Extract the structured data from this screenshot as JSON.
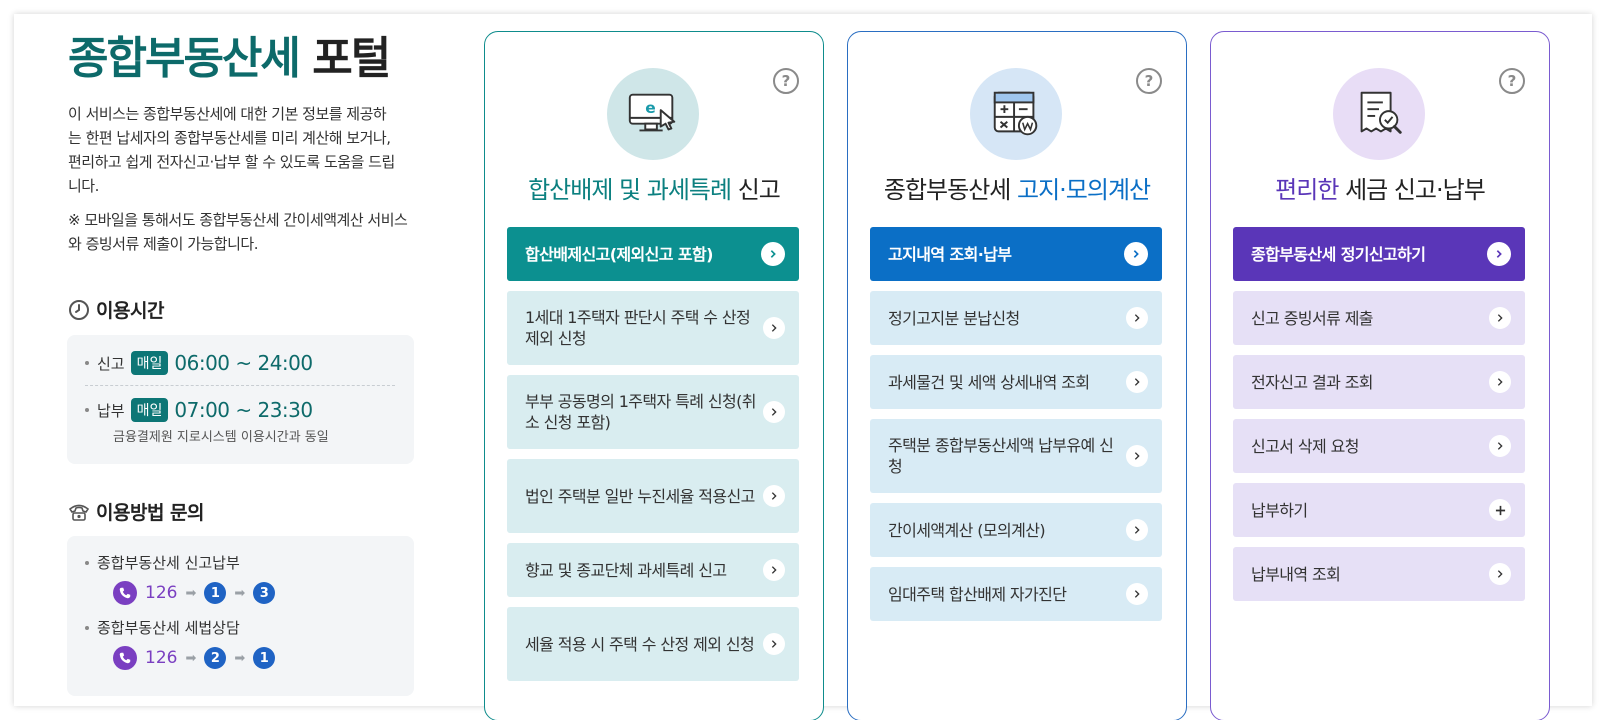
{
  "intro": {
    "title_accent": "종합부동산세",
    "title_rest": "포털",
    "desc": "이 서비스는 종합부동산세에 대한 기본 정보를 제공하는 한편 납세자의 종합부동산세를 미리 계산해 보거나, 편리하고 쉽게 전자신고·납부 할 수 있도록 도움을 드립니다.",
    "note": "※ 모바일을 통해서도 종합부동산세 간이세액계산 서비스와 증빙서류 제출이 가능합니다."
  },
  "hours": {
    "heading": "이용시간",
    "rows": [
      {
        "label": "신고",
        "badge": "매일",
        "time": "06:00 ~ 24:00"
      },
      {
        "label": "납부",
        "badge": "매일",
        "time": "07:00 ~ 23:30"
      }
    ],
    "sub": "금융결제원 지로시스템 이용시간과 동일"
  },
  "inquiry": {
    "heading": "이용방법 문의",
    "items": [
      {
        "label": "종합부동산세 신고납부",
        "phone": "126",
        "steps": [
          "1",
          "3"
        ]
      },
      {
        "label": "종합부동산세 세법상담",
        "phone": "126",
        "steps": [
          "2",
          "1"
        ]
      }
    ]
  },
  "cards": [
    {
      "help": "?",
      "title_a": "합산배제 및 과세특례",
      "title_b": "신고",
      "primary": "합산배제신고(제외신고 포함)",
      "items": [
        "1세대 1주택자 판단시 주택 수 산정 제외 신청",
        "부부 공동명의 1주택자 특례 신청(취소 신청 포함)",
        "법인 주택분 일반 누진세율 적용신고",
        "향교 및 종교단체 과세특례 신고",
        "세율 적용 시 주택 수 산정 제외 신청"
      ],
      "color": "#0c9090"
    },
    {
      "help": "?",
      "title_a": "종합부동산세",
      "title_b": "고지·모의계산",
      "primary": "고지내역 조회·납부",
      "items": [
        "정기고지분 분납신청",
        "과세물건 및 세액 상세내역 조회",
        "주택분 종합부동산세액 납부유예 신청",
        "간이세액계산 (모의계산)",
        "임대주택 합산배제 자가진단"
      ],
      "color": "#0b6fc6"
    },
    {
      "help": "?",
      "title_a": "편리한",
      "title_b": "세금 신고·납부",
      "primary": "종합부동산세 정기신고하기",
      "items": [
        "신고 증빙서류 제출",
        "전자신고 결과 조회",
        "신고서 삭제 요청",
        "납부하기",
        "납부내역 조회"
      ],
      "color": "#5a36b8"
    }
  ]
}
